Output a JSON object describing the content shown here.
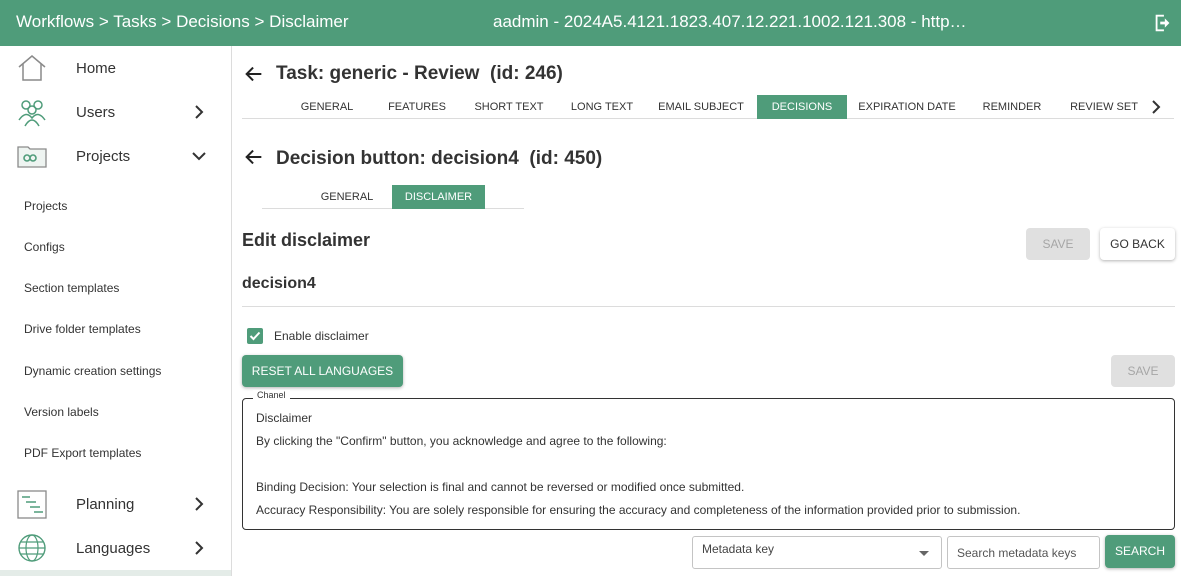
{
  "topbar": {
    "crumbs": [
      "Workflows",
      "Tasks",
      "Decisions",
      "Disclaimer"
    ],
    "separator": ">",
    "center_text": "aadmin - 2024A5.4121.1823.407.12.221.1002.121.308 - https://d..."
  },
  "sidebar": {
    "home": "Home",
    "users": "Users",
    "projects": "Projects",
    "sub_items": [
      "Projects",
      "Configs",
      "Section templates",
      "Drive folder templates",
      "Dynamic creation settings",
      "Version labels",
      "PDF Export templates"
    ],
    "planning": "Planning",
    "languages": "Languages"
  },
  "task": {
    "title": "Task: generic - Review",
    "id_label": "(id: 246)",
    "tabs": [
      "GENERAL",
      "FEATURES",
      "SHORT TEXT",
      "LONG TEXT",
      "EMAIL SUBJECT",
      "DECISIONS",
      "EXPIRATION DATE",
      "REMINDER",
      "REVIEW SET"
    ],
    "active_tab": "DECISIONS"
  },
  "decision": {
    "title": "Decision button: decision4",
    "id_label": "(id: 450)",
    "tabs": [
      "GENERAL",
      "DISCLAIMER"
    ],
    "active_tab": "DISCLAIMER"
  },
  "edit": {
    "heading": "Edit disclaimer",
    "save_label": "SAVE",
    "go_back_label": "GO BACK",
    "name": "decision4",
    "enable_label": "Enable disclaimer",
    "enabled": true,
    "reset_label": "RESET ALL LANGUAGES",
    "save2_label": "SAVE"
  },
  "disclaimer": {
    "legend": "Chanel",
    "lines": [
      "Disclaimer",
      "By clicking the \"Confirm\" button, you acknowledge and agree to the following:",
      "",
      "Binding Decision: Your selection is final and cannot be reversed or modified once submitted.",
      "Accuracy Responsibility: You are solely responsible for ensuring the accuracy and completeness of the information provided prior to submission."
    ]
  },
  "metadata": {
    "key_placeholder": "Metadata key",
    "search_placeholder": "Search metadata keys",
    "search_label": "SEARCH"
  },
  "colors": {
    "accent": "#4f9c7a",
    "disabled_bg": "#e0e0e0",
    "disabled_text": "#a6a6a6"
  }
}
